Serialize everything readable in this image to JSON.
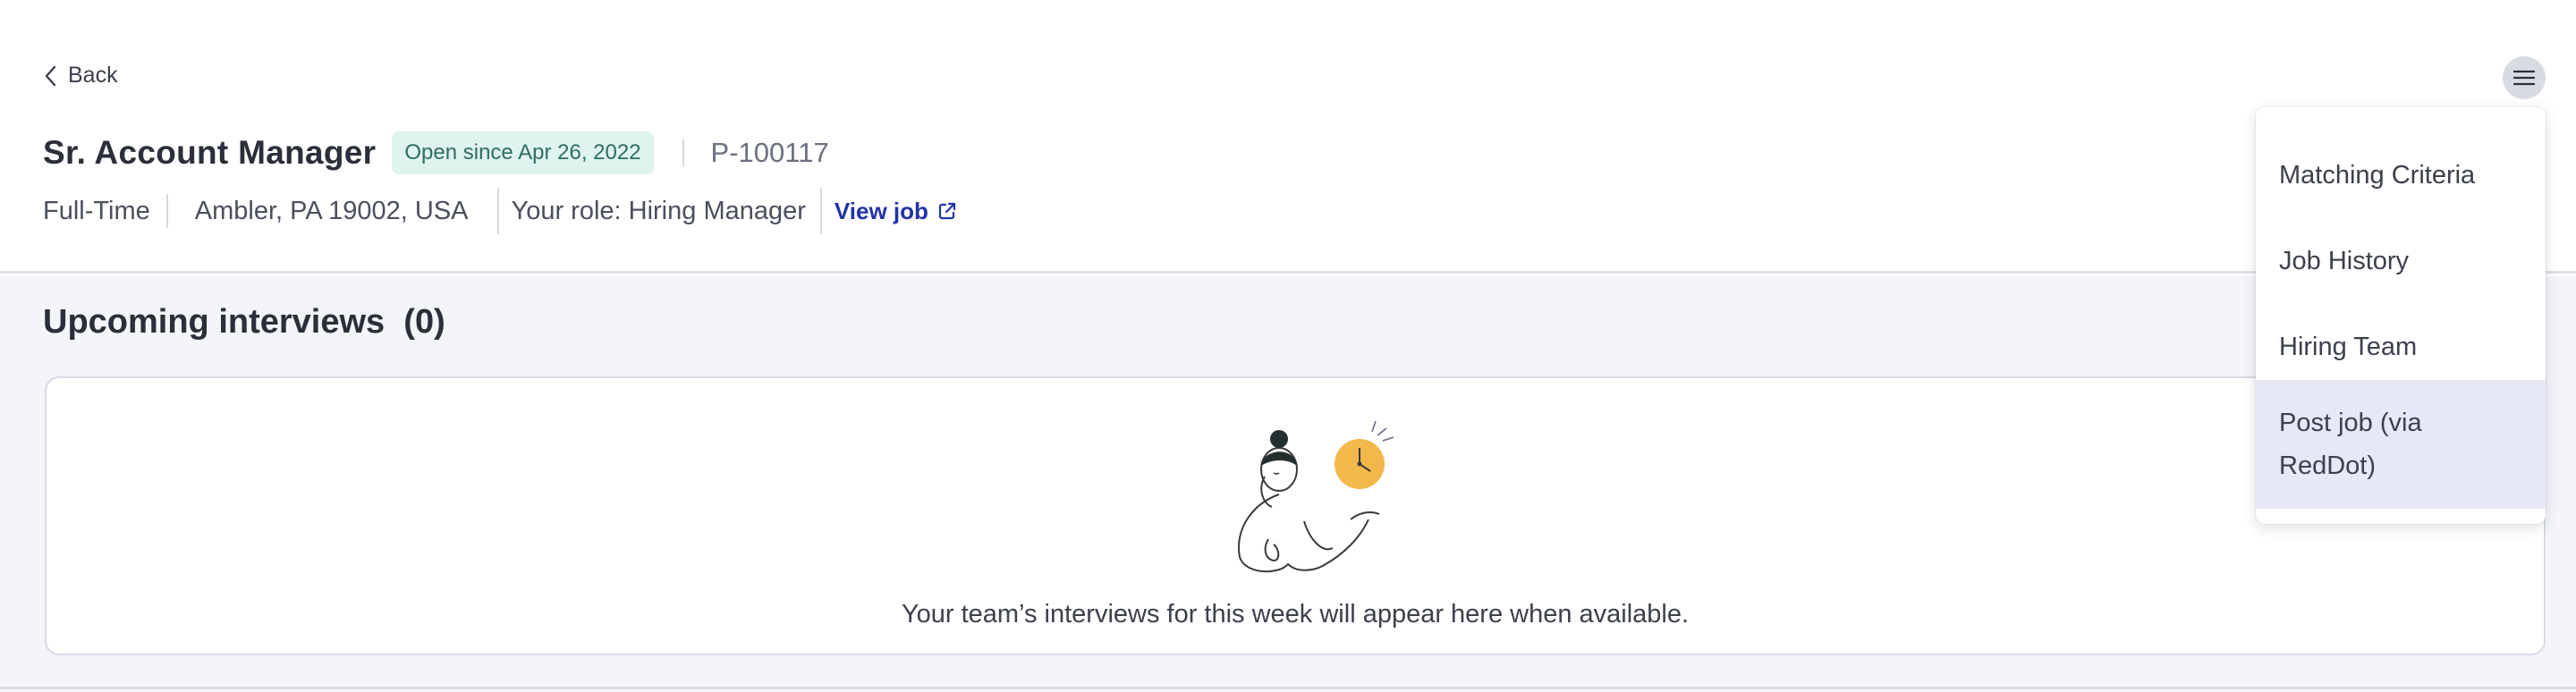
{
  "header": {
    "back_label": "Back",
    "job_title": "Sr. Account Manager",
    "status_badge": "Open since Apr 26, 2022",
    "req_id": "P-100117",
    "employment_type": "Full-Time",
    "location": "Ambler, PA 19002, USA",
    "role": "Your role: Hiring Manager",
    "view_job_label": "View job"
  },
  "main": {
    "section_title": "Upcoming interviews  (0)",
    "empty_message": "Your team’s interviews for this week will appear here when available."
  },
  "menu": {
    "icon": "hamburger-menu-icon",
    "items": [
      {
        "label": "Matching Criteria"
      },
      {
        "label": "Job History"
      },
      {
        "label": "Hiring Team"
      },
      {
        "label": "Post job (via RedDot)",
        "active": true
      }
    ]
  },
  "colors": {
    "accent_link": "#2233a8",
    "badge_bg": "#dff3ef",
    "badge_text": "#2f6e60",
    "page_bg": "#f4f5f9",
    "menu_highlight": "#e7e8f6",
    "clock": "#f2b84b"
  }
}
